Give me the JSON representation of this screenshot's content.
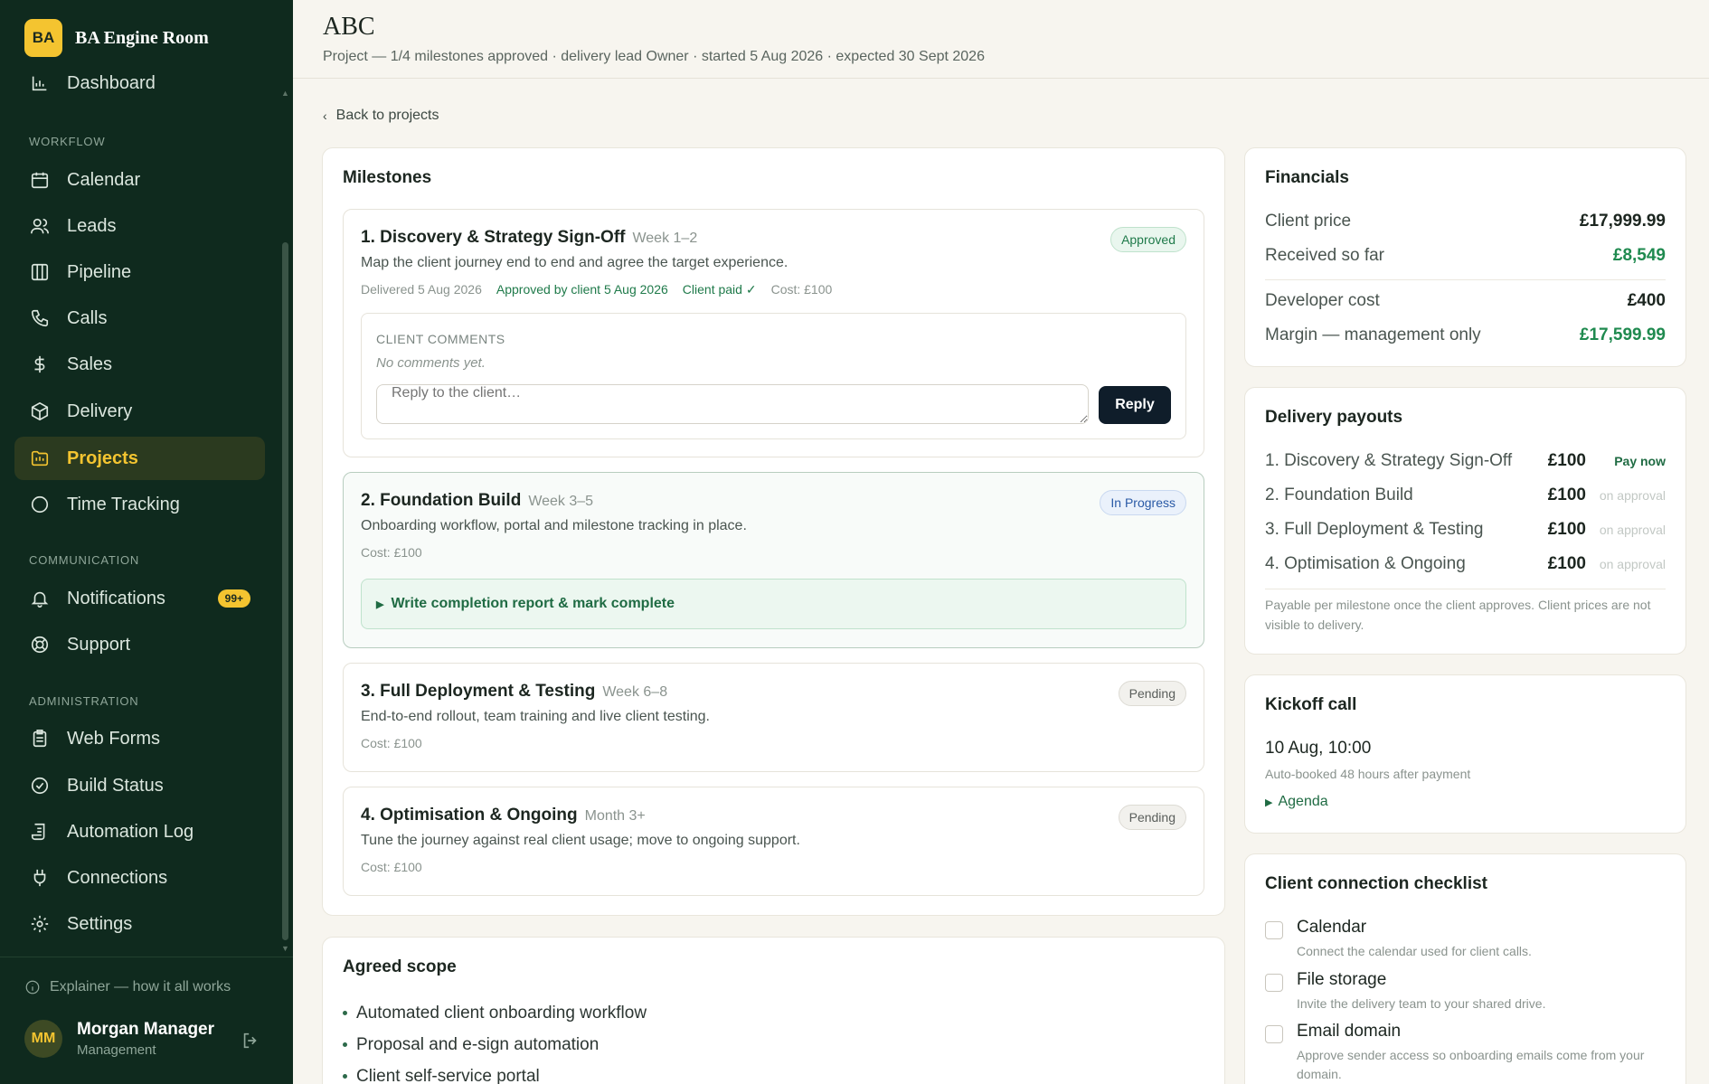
{
  "brand": {
    "logo": "BA",
    "name": "BA Engine Room"
  },
  "sidebar": {
    "partial_top_item": "Dashboard",
    "sections": {
      "workflow": "WORKFLOW",
      "communication": "COMMUNICATION",
      "administration": "ADMINISTRATION"
    },
    "workflow_items": [
      {
        "label": "Calendar",
        "icon": "calendar-icon"
      },
      {
        "label": "Leads",
        "icon": "users-icon"
      },
      {
        "label": "Pipeline",
        "icon": "columns-icon"
      },
      {
        "label": "Calls",
        "icon": "phone-icon"
      },
      {
        "label": "Sales",
        "icon": "dollar-icon"
      },
      {
        "label": "Delivery",
        "icon": "package-icon"
      },
      {
        "label": "Projects",
        "icon": "folder-icon",
        "active": true
      },
      {
        "label": "Time Tracking",
        "icon": "circle-icon"
      }
    ],
    "communication_items": [
      {
        "label": "Notifications",
        "icon": "bell-icon",
        "badge": "99+"
      },
      {
        "label": "Support",
        "icon": "lifebuoy-icon"
      }
    ],
    "administration_items": [
      {
        "label": "Web Forms",
        "icon": "clipboard-icon"
      },
      {
        "label": "Build Status",
        "icon": "check-circle-icon"
      },
      {
        "label": "Automation Log",
        "icon": "scroll-icon"
      },
      {
        "label": "Connections",
        "icon": "plug-icon"
      },
      {
        "label": "Settings",
        "icon": "gear-icon"
      }
    ],
    "explainer": "Explainer — how it all works",
    "user": {
      "initials": "MM",
      "name": "Morgan Manager",
      "role": "Management"
    }
  },
  "header": {
    "title": "ABC",
    "subtitle": "Project — 1/4 milestones approved · delivery lead Owner · started 5 Aug 2026 · expected 30 Sept 2026"
  },
  "back_link": "Back to projects",
  "milestones": {
    "title": "Milestones",
    "items": [
      {
        "title": "1. Discovery & Strategy Sign-Off",
        "week": "Week 1–2",
        "status": "Approved",
        "desc": "Map the client journey end to end and agree the target experience.",
        "delivered": "Delivered 5 Aug 2026",
        "approved": "Approved by client 5 Aug 2026",
        "paid": "Client paid ✓",
        "cost": "Cost: £100",
        "comments_label": "CLIENT COMMENTS",
        "comments_empty": "No comments yet.",
        "reply_placeholder": "Reply to the client…",
        "reply_button": "Reply"
      },
      {
        "title": "2. Foundation Build",
        "week": "Week 3–5",
        "status": "In Progress",
        "desc": "Onboarding workflow, portal and milestone tracking in place.",
        "cost": "Cost: £100",
        "complete_action": "Write completion report & mark complete"
      },
      {
        "title": "3. Full Deployment & Testing",
        "week": "Week 6–8",
        "status": "Pending",
        "desc": "End-to-end rollout, team training and live client testing.",
        "cost": "Cost: £100"
      },
      {
        "title": "4. Optimisation & Ongoing",
        "week": "Month 3+",
        "status": "Pending",
        "desc": "Tune the journey against real client usage; move to ongoing support.",
        "cost": "Cost: £100"
      }
    ]
  },
  "scope": {
    "title": "Agreed scope",
    "items": [
      "Automated client onboarding workflow",
      "Proposal and e-sign automation",
      "Client self-service portal"
    ]
  },
  "financials": {
    "title": "Financials",
    "client_price_label": "Client price",
    "client_price": "£17,999.99",
    "received_label": "Received so far",
    "received": "£8,549",
    "dev_cost_label": "Developer cost",
    "dev_cost": "£400",
    "margin_label": "Margin — management only",
    "margin": "£17,599.99"
  },
  "payouts": {
    "title": "Delivery payouts",
    "rows": [
      {
        "label": "1. Discovery & Strategy Sign-Off",
        "amount": "£100",
        "status": "Pay now"
      },
      {
        "label": "2. Foundation Build",
        "amount": "£100",
        "status": "on approval"
      },
      {
        "label": "3. Full Deployment & Testing",
        "amount": "£100",
        "status": "on approval"
      },
      {
        "label": "4. Optimisation & Ongoing",
        "amount": "£100",
        "status": "on approval"
      }
    ],
    "note": "Payable per milestone once the client approves. Client prices are not visible to delivery."
  },
  "kickoff": {
    "title": "Kickoff call",
    "datetime": "10 Aug, 10:00",
    "note": "Auto-booked 48 hours after payment",
    "agenda": "Agenda"
  },
  "checklist": {
    "title": "Client connection checklist",
    "items": [
      {
        "title": "Calendar",
        "desc": "Connect the calendar used for client calls."
      },
      {
        "title": "File storage",
        "desc": "Invite the delivery team to your shared drive."
      },
      {
        "title": "Email domain",
        "desc": "Approve sender access so onboarding emails come from your domain."
      }
    ]
  },
  "colors": {
    "sidebar_bg": "#0f2a1e",
    "accent": "#f4c430",
    "success": "#1f8a4f",
    "reply_button": "#0f1d2a"
  }
}
